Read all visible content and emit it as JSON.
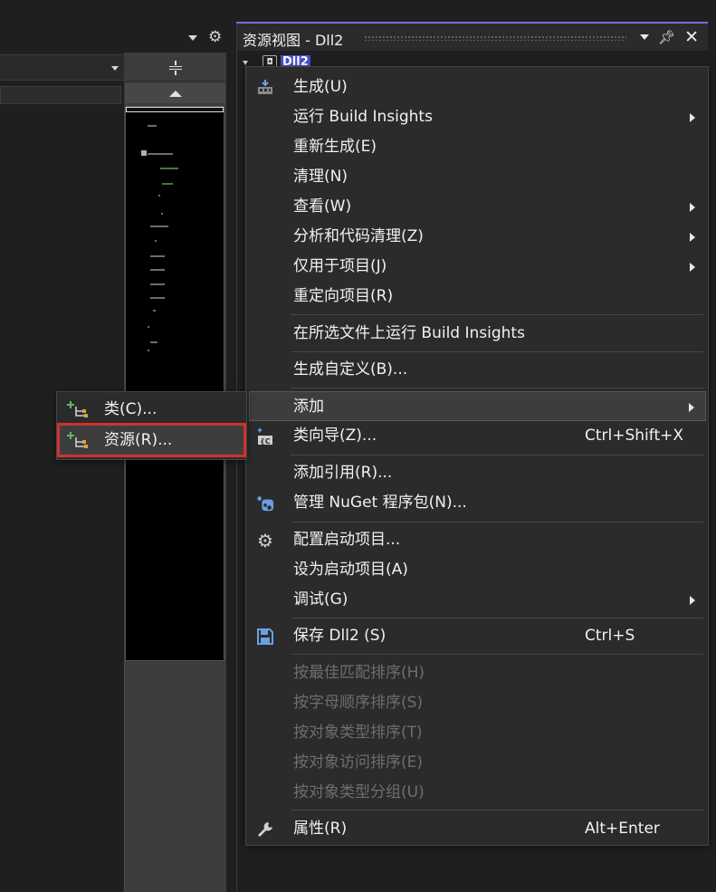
{
  "editor": {
    "toolbar": {
      "dropdown_icon": "chevron-down-icon",
      "settings_icon": "gear-icon"
    },
    "split_icon": "split-window-icon",
    "scroll_up_icon": "triangle-up-icon"
  },
  "resource_view": {
    "title": "资源视图 - Dll2",
    "tree_root": {
      "label": "Dll2",
      "icon": "resource-project-icon",
      "expanded": true
    }
  },
  "context_menu": {
    "items": [
      {
        "label": "生成(U)",
        "icon": "build-icon"
      },
      {
        "label": "运行 Build Insights",
        "submenu": true
      },
      {
        "label": "重新生成(E)"
      },
      {
        "label": "清理(N)"
      },
      {
        "label": "查看(W)",
        "submenu": true
      },
      {
        "label": "分析和代码清理(Z)",
        "submenu": true
      },
      {
        "label": "仅用于项目(J)",
        "submenu": true
      },
      {
        "label": "重定向项目(R)"
      },
      {
        "label": "在所选文件上运行 Build Insights"
      },
      {
        "label": "生成自定义(B)..."
      },
      {
        "label": "添加",
        "submenu": true,
        "highlighted": true
      },
      {
        "label": "类向导(Z)...",
        "shortcut": "Ctrl+Shift+X",
        "icon": "class-wizard-icon"
      },
      {
        "label": "添加引用(R)..."
      },
      {
        "label": "管理 NuGet 程序包(N)...",
        "icon": "nuget-icon"
      },
      {
        "label": "配置启动项目...",
        "icon": "gear-icon"
      },
      {
        "label": "设为启动项目(A)"
      },
      {
        "label": "调试(G)",
        "submenu": true
      },
      {
        "label": "保存 Dll2 (S)",
        "shortcut": "Ctrl+S",
        "icon": "save-icon"
      },
      {
        "label": "按最佳匹配排序(H)",
        "disabled": true
      },
      {
        "label": "按字母顺序排序(S)",
        "disabled": true
      },
      {
        "label": "按对象类型排序(T)",
        "disabled": true
      },
      {
        "label": "按对象访问排序(E)",
        "disabled": true
      },
      {
        "label": "按对象类型分组(U)",
        "disabled": true
      },
      {
        "label": "属性(R)",
        "shortcut": "Alt+Enter",
        "icon": "wrench-icon"
      }
    ]
  },
  "add_submenu": {
    "items": [
      {
        "label": "类(C)...",
        "icon": "add-class-icon"
      },
      {
        "label": "资源(R)...",
        "icon": "add-resource-icon",
        "selected": true
      }
    ]
  },
  "colors": {
    "accent": "#7b6bd6",
    "selection_outline": "#d0322d",
    "menu_bg": "#2b2b2b",
    "disabled_text": "#6e6e6e"
  }
}
